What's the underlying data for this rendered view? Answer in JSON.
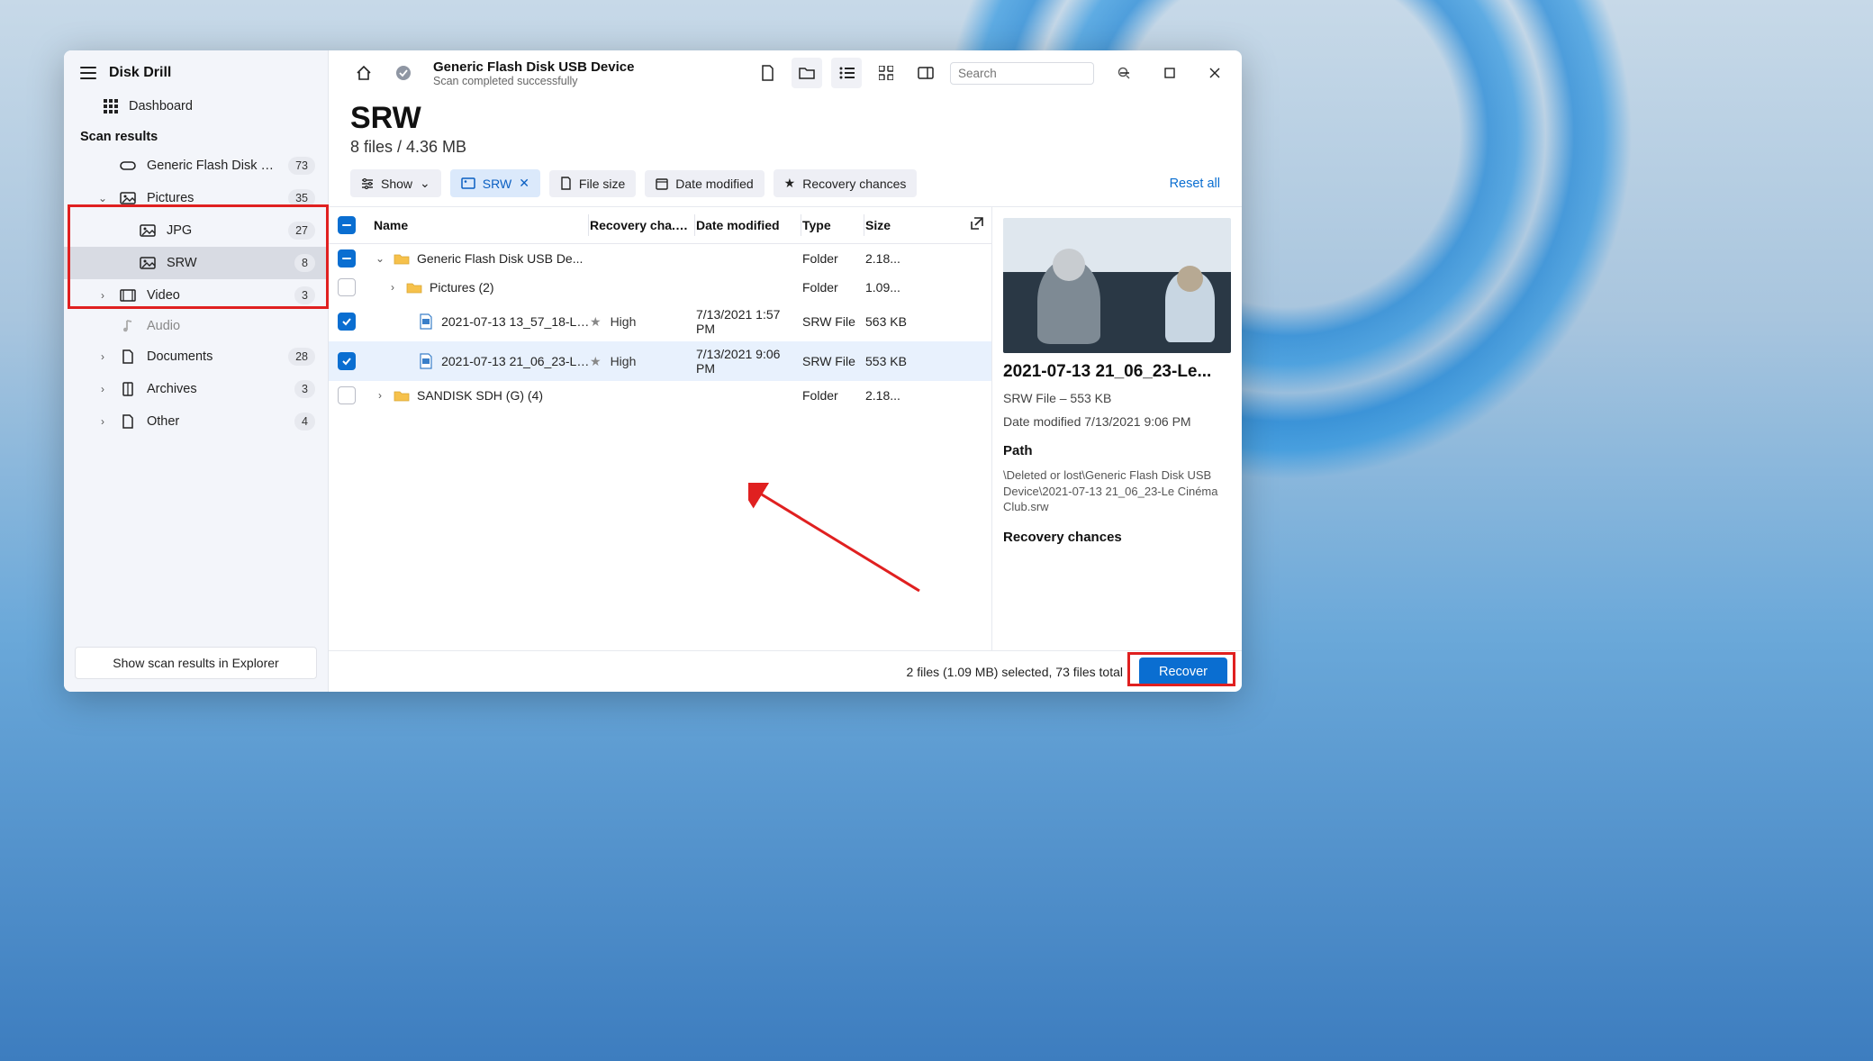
{
  "app": {
    "title": "Disk Drill"
  },
  "sidebar": {
    "dashboard": "Dashboard",
    "section": "Scan results",
    "items": [
      {
        "label": "Generic Flash Disk USB D...",
        "badge": "73"
      },
      {
        "label": "Pictures",
        "badge": "35"
      },
      {
        "label": "JPG",
        "badge": "27"
      },
      {
        "label": "SRW",
        "badge": "8"
      },
      {
        "label": "Video",
        "badge": "3"
      },
      {
        "label": "Audio",
        "badge": ""
      },
      {
        "label": "Documents",
        "badge": "28"
      },
      {
        "label": "Archives",
        "badge": "3"
      },
      {
        "label": "Other",
        "badge": "4"
      }
    ],
    "footer_btn": "Show scan results in Explorer"
  },
  "topbar": {
    "title": "Generic Flash Disk USB Device",
    "subtitle": "Scan completed successfully",
    "search_placeholder": "Search"
  },
  "heading": {
    "title": "SRW",
    "sub": "8 files / 4.36 MB"
  },
  "filters": {
    "show": "Show",
    "srw": "SRW",
    "filesize": "File size",
    "datemod": "Date modified",
    "recovchances": "Recovery chances",
    "reset": "Reset all"
  },
  "columns": {
    "name": "Name",
    "recov": "Recovery cha...",
    "date": "Date modified",
    "type": "Type",
    "size": "Size"
  },
  "rows": [
    {
      "name": "Generic Flash Disk USB De...",
      "recov": "",
      "date": "",
      "type": "Folder",
      "size": "2.18..."
    },
    {
      "name": "Pictures (2)",
      "recov": "",
      "date": "",
      "type": "Folder",
      "size": "1.09..."
    },
    {
      "name": "2021-07-13 13_57_18-Le...",
      "recov": "High",
      "date": "7/13/2021 1:57 PM",
      "type": "SRW File",
      "size": "563 KB"
    },
    {
      "name": "2021-07-13 21_06_23-Le...",
      "recov": "High",
      "date": "7/13/2021 9:06 PM",
      "type": "SRW File",
      "size": "553 KB"
    },
    {
      "name": "SANDISK SDH (G) (4)",
      "recov": "",
      "date": "",
      "type": "Folder",
      "size": "2.18..."
    }
  ],
  "details": {
    "title": "2021-07-13 21_06_23-Le...",
    "line1": "SRW File – 553 KB",
    "line2": "Date modified 7/13/2021 9:06 PM",
    "path_label": "Path",
    "path": "\\Deleted or lost\\Generic Flash Disk USB Device\\2021-07-13 21_06_23-Le Cinéma Club.srw",
    "recov_label": "Recovery chances"
  },
  "footer": {
    "status": "2 files (1.09 MB) selected, 73 files total",
    "recover": "Recover"
  }
}
